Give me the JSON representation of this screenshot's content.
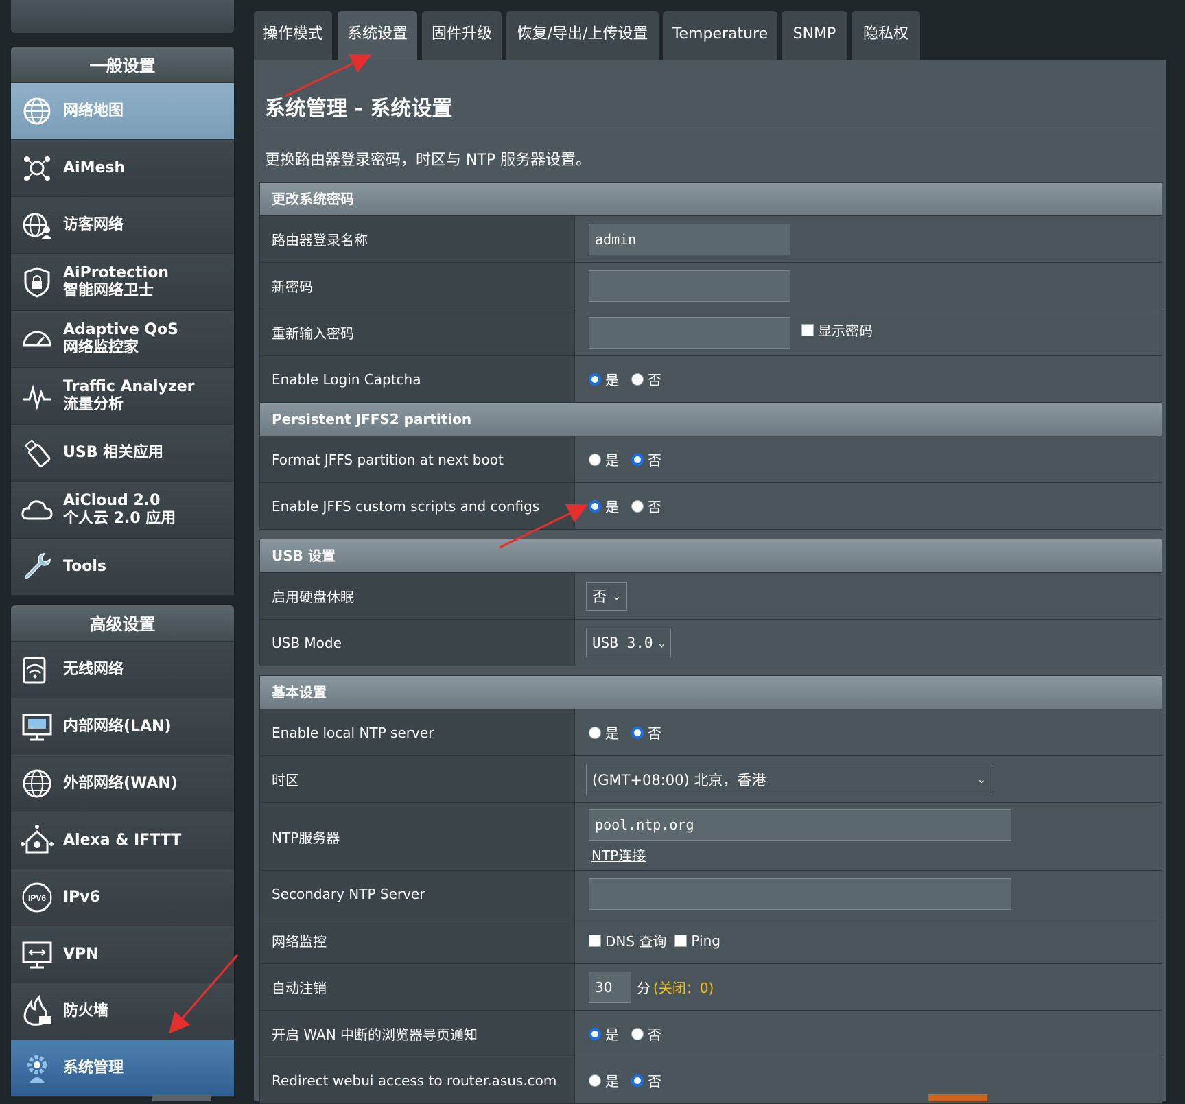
{
  "sidebar": {
    "general_title": "一般设置",
    "general_items": [
      {
        "label1": "网络地图",
        "label2": ""
      },
      {
        "label1": "AiMesh",
        "label2": ""
      },
      {
        "label1": "访客网络",
        "label2": ""
      },
      {
        "label1": "AiProtection",
        "label2": "智能网络卫士"
      },
      {
        "label1": "Adaptive QoS",
        "label2": "网络监控家"
      },
      {
        "label1": "Traffic Analyzer",
        "label2": "流量分析"
      },
      {
        "label1": "USB 相关应用",
        "label2": ""
      },
      {
        "label1": "AiCloud 2.0",
        "label2": "个人云 2.0 应用"
      },
      {
        "label1": "Tools",
        "label2": ""
      }
    ],
    "advanced_title": "高级设置",
    "advanced_items": [
      {
        "label1": "无线网络"
      },
      {
        "label1": "内部网络(LAN)"
      },
      {
        "label1": "外部网络(WAN)"
      },
      {
        "label1": "Alexa & IFTTT"
      },
      {
        "label1": "IPv6"
      },
      {
        "label1": "VPN"
      },
      {
        "label1": "防火墙"
      },
      {
        "label1": "系统管理"
      }
    ]
  },
  "tabs": [
    "操作模式",
    "系统设置",
    "固件升级",
    "恢复/导出/上传设置",
    "Temperature",
    "SNMP",
    "隐私权"
  ],
  "page": {
    "title": "系统管理 - 系统设置",
    "description": "更换路由器登录密码，时区与 NTP 服务器设置。"
  },
  "sections": {
    "password": {
      "title": "更改系统密码",
      "login_name_label": "路由器登录名称",
      "login_name_value": "admin",
      "new_password_label": "新密码",
      "retype_password_label": "重新输入密码",
      "show_password_label": "显示密码",
      "captcha_label": "Enable Login Captcha"
    },
    "jffs": {
      "title": "Persistent JFFS2 partition",
      "format_label": "Format JFFS partition at next boot",
      "scripts_label": "Enable JFFS custom scripts and configs"
    },
    "usb": {
      "title": "USB 设置",
      "hdd_sleep_label": "启用硬盘休眠",
      "hdd_sleep_value": "否",
      "usb_mode_label": "USB Mode",
      "usb_mode_value": "USB 3.0"
    },
    "basic": {
      "title": "基本设置",
      "local_ntp_label": "Enable local NTP server",
      "timezone_label": "时区",
      "timezone_value": "(GMT+08:00) 北京，香港",
      "ntp_label": "NTP服务器",
      "ntp_value": "pool.ntp.org",
      "ntp_link": "NTP连接",
      "secondary_ntp_label": "Secondary NTP Server",
      "monitor_label": "网络监控",
      "monitor_dns": "DNS 查询",
      "monitor_ping": "Ping",
      "auto_logout_label": "自动注销",
      "auto_logout_value": "30",
      "auto_logout_unit": "分",
      "auto_logout_note": "(关闭：0)",
      "wan_notify_label": "开启 WAN 中断的浏览器导页通知",
      "redirect_label": "Redirect webui access to router.asus.com"
    }
  },
  "radio": {
    "yes": "是",
    "no": "否"
  },
  "state": {
    "captcha": "yes",
    "format_jffs": "no",
    "jffs_scripts": "yes",
    "local_ntp": "no",
    "wan_notify": "yes",
    "redirect": "no"
  },
  "colors": {
    "accent": "#1a6fe8",
    "note": "#f3c200",
    "arrow": "#e62e2e"
  }
}
